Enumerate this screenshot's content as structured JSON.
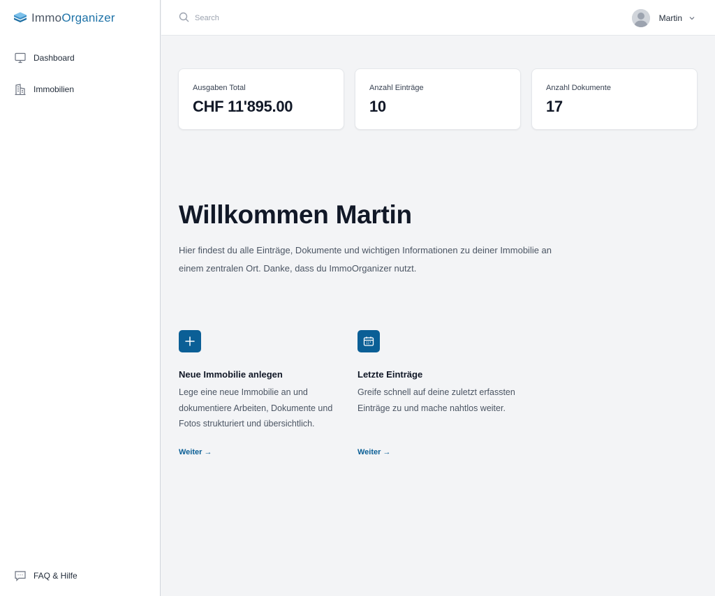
{
  "brand": {
    "part1": "Immo",
    "part2": "Organizer",
    "accent": "#1f73a8"
  },
  "sidebar": {
    "items": [
      {
        "label": "Dashboard",
        "icon": "monitor-icon"
      },
      {
        "label": "Immobilien",
        "icon": "building-icon"
      }
    ],
    "footer": {
      "label": "FAQ & Hilfe",
      "icon": "chat-icon"
    }
  },
  "header": {
    "search": {
      "placeholder": "Search",
      "value": ""
    },
    "user": {
      "name": "Martin"
    }
  },
  "stats": [
    {
      "label": "Ausgaben Total",
      "value": "CHF 11'895.00"
    },
    {
      "label": "Anzahl Einträge",
      "value": "10"
    },
    {
      "label": "Anzahl Dokumente",
      "value": "17"
    }
  ],
  "welcome": {
    "title": "Willkommen Martin",
    "text": "Hier findest du alle Einträge, Dokumente und wichtigen Informationen zu deiner Immobilie an einem zentralen Ort. Danke, dass du ImmoOrganizer nutzt."
  },
  "features": [
    {
      "icon": "plus-icon",
      "title": "Neue Immobilie anlegen",
      "description": "Lege eine neue Immobilie an und dokumentiere Arbeiten, Dokumente und Fotos strukturiert und übersichtlich.",
      "link": "Weiter →"
    },
    {
      "icon": "calendar-icon",
      "title": "Letzte Einträge",
      "description": "Greife schnell auf deine zuletzt erfassten Einträge zu und mache nahtlos weiter.",
      "link": "Weiter →"
    }
  ],
  "colors": {
    "primary": "#0b5f96",
    "background": "#f3f4f6"
  }
}
